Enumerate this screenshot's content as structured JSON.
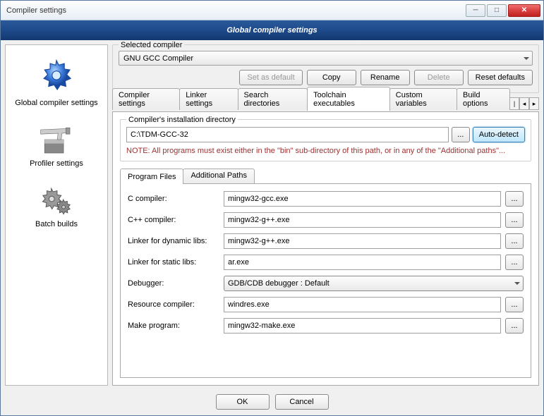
{
  "window_title": "Compiler settings",
  "banner_title": "Global compiler settings",
  "sidebar": {
    "items": [
      {
        "label": "Global compiler settings"
      },
      {
        "label": "Profiler settings"
      },
      {
        "label": "Batch builds"
      }
    ]
  },
  "selected_compiler": {
    "group_label": "Selected compiler",
    "value": "GNU GCC Compiler",
    "buttons": {
      "set_default": "Set as default",
      "copy": "Copy",
      "rename": "Rename",
      "delete": "Delete",
      "reset": "Reset defaults"
    }
  },
  "tabs": {
    "items": [
      "Compiler settings",
      "Linker settings",
      "Search directories",
      "Toolchain executables",
      "Custom variables",
      "Build options"
    ]
  },
  "install": {
    "group_label": "Compiler's installation directory",
    "path": "C:\\TDM-GCC-32",
    "auto_detect": "Auto-detect",
    "note": "NOTE: All programs must exist either in the \"bin\" sub-directory of this path, or in any of the \"Additional paths\"..."
  },
  "sub_tabs": {
    "items": [
      "Program Files",
      "Additional Paths"
    ]
  },
  "programs": {
    "rows": [
      {
        "label": "C compiler:",
        "value": "mingw32-gcc.exe"
      },
      {
        "label": "C++ compiler:",
        "value": "mingw32-g++.exe"
      },
      {
        "label": "Linker for dynamic libs:",
        "value": "mingw32-g++.exe"
      },
      {
        "label": "Linker for static libs:",
        "value": "ar.exe"
      },
      {
        "label": "Debugger:",
        "value": "GDB/CDB debugger : Default",
        "combo": true
      },
      {
        "label": "Resource compiler:",
        "value": "windres.exe"
      },
      {
        "label": "Make program:",
        "value": "mingw32-make.exe"
      }
    ]
  },
  "dialog": {
    "ok": "OK",
    "cancel": "Cancel"
  },
  "glyphs": {
    "ellipsis": "...",
    "left": "◂",
    "right": "▸",
    "bar": "|"
  }
}
